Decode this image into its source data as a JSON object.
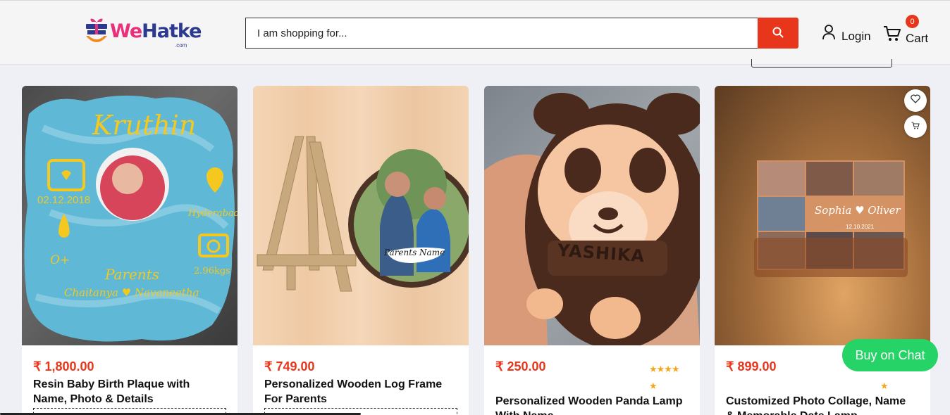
{
  "header": {
    "logo_text_we": "We",
    "logo_text_hatke": "Hatke",
    "logo_sub": ".com",
    "search_placeholder": "I am shopping for...",
    "login_label": "Login",
    "cart_label": "Cart",
    "cart_count": "0"
  },
  "products": [
    {
      "price": "₹ 1,800.00",
      "title": "Resin Baby Birth Plaque with Name, Photo & Details",
      "image_text": {
        "name": "Kruthin",
        "date": "02.12.2018",
        "city": "Hyderabad",
        "blood": "O+",
        "weight": "2.96kgs",
        "parents_label": "Parents",
        "parents_names": "Chaitanya ♥ Navaneetha"
      }
    },
    {
      "price": "₹ 749.00",
      "title": "Personalized Wooden Log Frame For Parents",
      "image_text": {
        "tag": "Parents Name"
      }
    },
    {
      "price": "₹ 250.00",
      "title": "Personalized Wooden Panda Lamp With Name",
      "stars": "★★★★",
      "half": "★",
      "image_text": {
        "name": "YASHIKA"
      }
    },
    {
      "price": "₹ 899.00",
      "title": "Customized Photo Collage, Name & Memorable Date Lamp",
      "half": "★",
      "image_text": {
        "names": "Sophia ♥ Oliver",
        "date": "12.10.2021"
      }
    }
  ],
  "chat_button": "Buy on Chat",
  "colors": {
    "accent": "#e7361b",
    "chat": "#25d366",
    "brand_pink": "#e8307b",
    "brand_navy": "#2b3a8f"
  },
  "icons": [
    "search-icon",
    "user-icon",
    "cart-icon",
    "heart-icon",
    "add-to-cart-icon"
  ]
}
